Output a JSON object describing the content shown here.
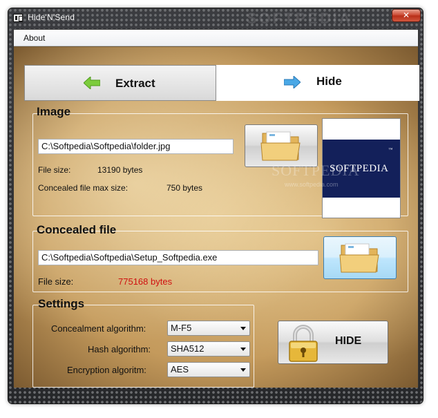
{
  "window": {
    "title": "Hide'N'Send",
    "title_watermark": "SOFTPEDIA",
    "close_glyph": "✕"
  },
  "menu": {
    "items": [
      {
        "label": "About"
      }
    ]
  },
  "tabs": [
    {
      "label": "Extract",
      "icon": "left-arrow-icon"
    },
    {
      "label": "Hide",
      "icon": "right-arrow-icon",
      "selected": true
    }
  ],
  "image_group": {
    "title": "Image",
    "path": "C:\\Softpedia\\Softpedia\\folder.jpg",
    "file_size_label": "File size:",
    "file_size_value": "13190 bytes",
    "max_size_label": "Concealed file max size:",
    "max_size_value": "750 bytes",
    "preview_text": "SOFTPEDIA",
    "preview_tm": "™",
    "browse_icon": "folder-icon"
  },
  "watermark": {
    "text": "SOFTPEDIA",
    "url": "www.softpedia.com"
  },
  "concealed_group": {
    "title": "Concealed file",
    "path": "C:\\Softpedia\\Softpedia\\Setup_Softpedia.exe",
    "file_size_label": "File size:",
    "file_size_value": "775168 bytes",
    "browse_icon": "folder-icon"
  },
  "settings_group": {
    "title": "Settings",
    "rows": [
      {
        "label": "Concealment algorithm:",
        "value": "M-F5"
      },
      {
        "label": "Hash algorithm:",
        "value": "SHA512"
      },
      {
        "label": "Encryption algoritm:",
        "value": "AES"
      }
    ]
  },
  "hide_button": {
    "label": "HIDE",
    "icon": "padlock-icon"
  },
  "colors": {
    "parchment": "#d8b77f",
    "accent_red": "#d01010",
    "preview_blue": "#13205a"
  }
}
